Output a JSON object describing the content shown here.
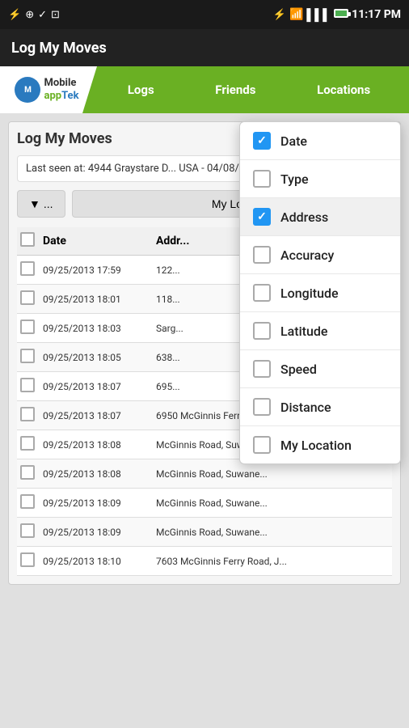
{
  "statusBar": {
    "time": "11:17 PM",
    "icons_left": [
      "usb-icon",
      "app-icon1",
      "checkmark-icon",
      "inbox-icon"
    ],
    "icons_right": [
      "bluetooth-icon",
      "wifi-icon",
      "signal-icon",
      "battery-icon"
    ]
  },
  "appBar": {
    "title": "Log My Moves"
  },
  "navBar": {
    "logo": {
      "mobile": "Mobile",
      "app": "app",
      "tek": "Tek"
    },
    "items": [
      {
        "label": "Logs"
      },
      {
        "label": "Friends"
      },
      {
        "label": "Locations"
      }
    ]
  },
  "card": {
    "title": "Log My Moves",
    "lastSeen": "Last seen at: 4944 Graystare D... USA - 04/08/2014 23:14",
    "filterBtn": "▼  ...",
    "myLogBtn": "My Lo..."
  },
  "tableHeader": {
    "checkLabel": "",
    "dateLabel": "Date",
    "addressLabel": "Addr..."
  },
  "tableRows": [
    {
      "date": "09/25/2013 17:59",
      "address": "122..."
    },
    {
      "date": "09/25/2013 18:01",
      "address": "118..."
    },
    {
      "date": "09/25/2013 18:03",
      "address": "Sarg..."
    },
    {
      "date": "09/25/2013 18:05",
      "address": "638..."
    },
    {
      "date": "09/25/2013 18:07",
      "address": "695..."
    },
    {
      "date": "09/25/2013 18:07",
      "address": "6950 McGinnis Ferry Road, J..."
    },
    {
      "date": "09/25/2013 18:08",
      "address": "McGinnis Road, Suwane..."
    },
    {
      "date": "09/25/2013 18:08",
      "address": "McGinnis Road, Suwane..."
    },
    {
      "date": "09/25/2013 18:09",
      "address": "McGinnis Road, Suwane..."
    },
    {
      "date": "09/25/2013 18:09",
      "address": "McGinnis Road, Suwane..."
    },
    {
      "date": "09/25/2013 18:10",
      "address": "7603 McGinnis Ferry Road, J..."
    }
  ],
  "dropdownMenu": {
    "items": [
      {
        "label": "Date",
        "checked": true
      },
      {
        "label": "Type",
        "checked": false
      },
      {
        "label": "Address",
        "checked": true
      },
      {
        "label": "Accuracy",
        "checked": false
      },
      {
        "label": "Longitude",
        "checked": false
      },
      {
        "label": "Latitude",
        "checked": false
      },
      {
        "label": "Speed",
        "checked": false
      },
      {
        "label": "Distance",
        "checked": false
      },
      {
        "label": "My Location",
        "checked": false
      }
    ]
  }
}
